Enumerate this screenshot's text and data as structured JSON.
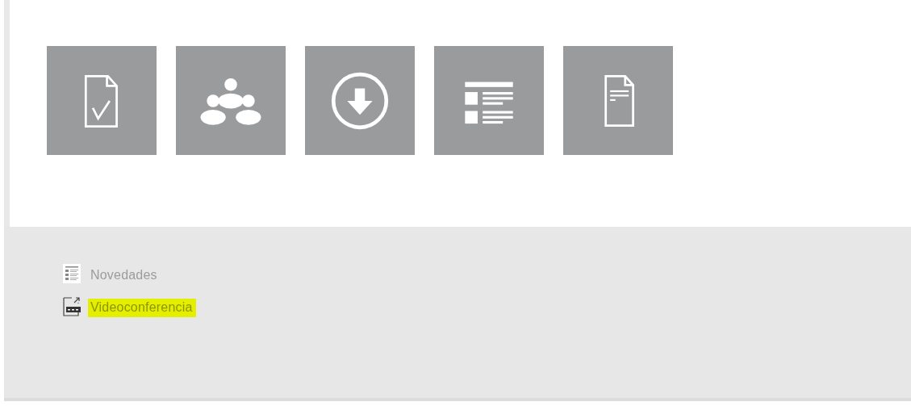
{
  "tiles": [
    {
      "kind": "check-document"
    },
    {
      "kind": "people"
    },
    {
      "kind": "download"
    },
    {
      "kind": "list"
    },
    {
      "kind": "document"
    }
  ],
  "links": [
    {
      "kind": "list",
      "label": "Novedades",
      "highlighted": false
    },
    {
      "kind": "web",
      "label": "Videoconferencia",
      "highlighted": true
    }
  ]
}
